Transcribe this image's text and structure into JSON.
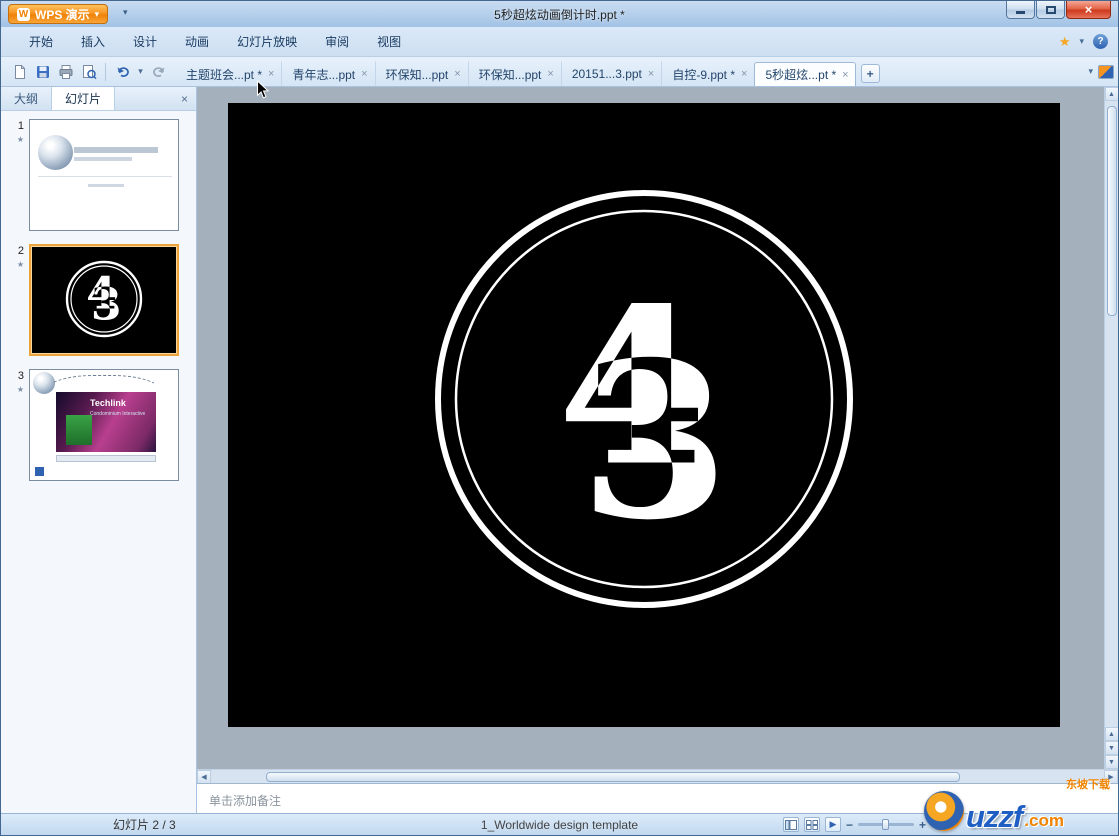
{
  "window": {
    "app_button_label": "WPS 演示",
    "logo_glyph": "W",
    "title": "5秒超炫动画倒计时.ppt *"
  },
  "icons": {
    "caret_down": "▾",
    "close": "×",
    "help": "?",
    "star": "★",
    "plus": "+",
    "minus": "−",
    "arrow_left": "◀",
    "arrow_right": "▶",
    "arrow_up": "▲",
    "arrow_down": "▼",
    "play": "▶",
    "anim_star": "★"
  },
  "menubar": {
    "items": [
      {
        "label": "开始"
      },
      {
        "label": "插入"
      },
      {
        "label": "设计"
      },
      {
        "label": "动画"
      },
      {
        "label": "幻灯片放映"
      },
      {
        "label": "审阅"
      },
      {
        "label": "视图"
      }
    ]
  },
  "toolbar": {
    "tabs": [
      {
        "label": "主题班会...pt *"
      },
      {
        "label": "青年志...ppt"
      },
      {
        "label": "环保知...ppt"
      },
      {
        "label": "环保知...ppt"
      },
      {
        "label": "20151...3.ppt"
      },
      {
        "label": "自控-9.ppt *"
      },
      {
        "label": "5秒超炫...pt *"
      }
    ]
  },
  "sidebar": {
    "outline_tab": "大纲",
    "slides_tab": "幻灯片",
    "slides": [
      {
        "number": "1"
      },
      {
        "number": "2"
      },
      {
        "number": "3",
        "caption": "Techlink",
        "subcaption": "Condominium Interactive"
      }
    ]
  },
  "canvas": {
    "countdown_digits": [
      "4",
      "3"
    ]
  },
  "notes": {
    "placeholder": "单击添加备注"
  },
  "statusbar": {
    "slide_counter": "幻灯片 2 / 3",
    "template_name": "1_Worldwide design template"
  },
  "watermark": {
    "brand": "uzzf",
    "domain": ".com",
    "site_name": "东坡下载"
  }
}
